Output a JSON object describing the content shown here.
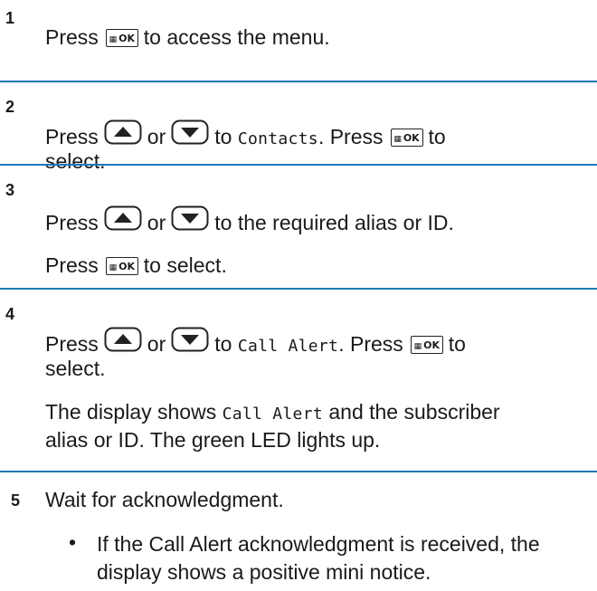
{
  "steps": [
    {
      "num": "1",
      "lines": {
        "a": "Press",
        "b": "to access the menu."
      }
    },
    {
      "num": "2",
      "lines": {
        "a": "Press",
        "or": "or",
        "to": "to",
        "mono": "Contacts",
        "press": ". Press",
        "to2": "to",
        "c": "select."
      }
    },
    {
      "num": "3",
      "lines": {
        "a": "Press",
        "or": "or",
        "b": "to the required alias or ID.",
        "c": "Press",
        "d": "to select."
      }
    },
    {
      "num": "4",
      "lines": {
        "a": "Press",
        "or": "or",
        "to": "to",
        "mono": "Call Alert",
        "press": ". Press",
        "to2": "to",
        "c": "select.",
        "d1": "The display shows",
        "dmono": "Call Alert",
        "d2": "and the subscriber",
        "e": "alias or ID. The green LED lights up."
      }
    },
    {
      "num": "5",
      "lines": {
        "a": "Wait for acknowledgment.",
        "bullet": "•",
        "b1": "If the Call Alert acknowledgment is received, the",
        "b2": "display shows a positive mini notice."
      }
    }
  ],
  "keys": {
    "ok": "OK",
    "ok_icon": "menu-ok-key-icon",
    "up_icon": "up-arrow-key-icon",
    "down_icon": "down-arrow-key-icon"
  },
  "colors": {
    "divider": "#1f78b4"
  }
}
